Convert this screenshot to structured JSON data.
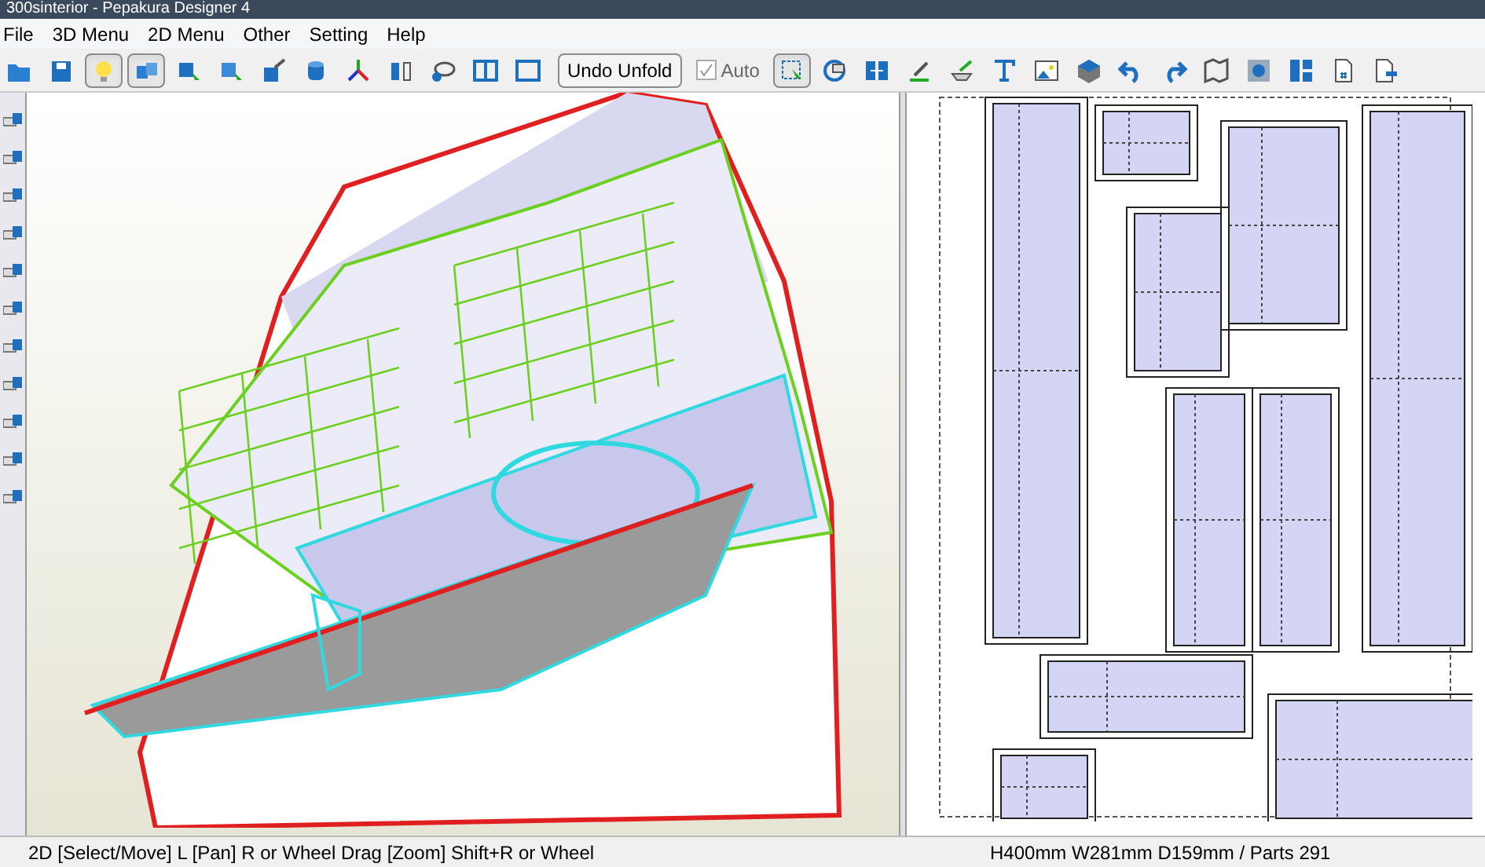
{
  "window": {
    "title": "300sinterior - Pepakura Designer 4"
  },
  "menu": [
    "File",
    "3D Menu",
    "2D Menu",
    "Other",
    "Setting",
    "Help"
  ],
  "toolbar_left": [
    {
      "selected": false
    },
    {
      "selected": false
    },
    {
      "selected": true
    },
    {
      "selected": true
    },
    {
      "selected": false
    },
    {
      "selected": false
    },
    {
      "selected": false
    },
    {
      "selected": false
    },
    {
      "selected": false
    },
    {
      "selected": false
    },
    {
      "selected": false
    },
    {
      "selected": false
    },
    {
      "selected": false
    }
  ],
  "undo_button": "Undo Unfold",
  "auto_checkbox": {
    "label": "Auto",
    "checked": true
  },
  "toolbar_right": [
    {
      "selected": true
    },
    {
      "selected": false
    },
    {
      "selected": false
    },
    {
      "selected": false
    },
    {
      "selected": false
    },
    {
      "selected": false
    },
    {
      "selected": false
    },
    {
      "selected": false
    },
    {
      "selected": false
    },
    {
      "selected": false
    },
    {
      "selected": false
    },
    {
      "selected": false
    },
    {
      "selected": false
    },
    {
      "selected": false
    },
    {
      "selected": false
    }
  ],
  "status_bar": {
    "hint": "2D [Select/Move] L [Pan] R or Wheel Drag [Zoom] Shift+R or Wheel",
    "info": "H400mm W281mm D159mm / Parts 291"
  }
}
